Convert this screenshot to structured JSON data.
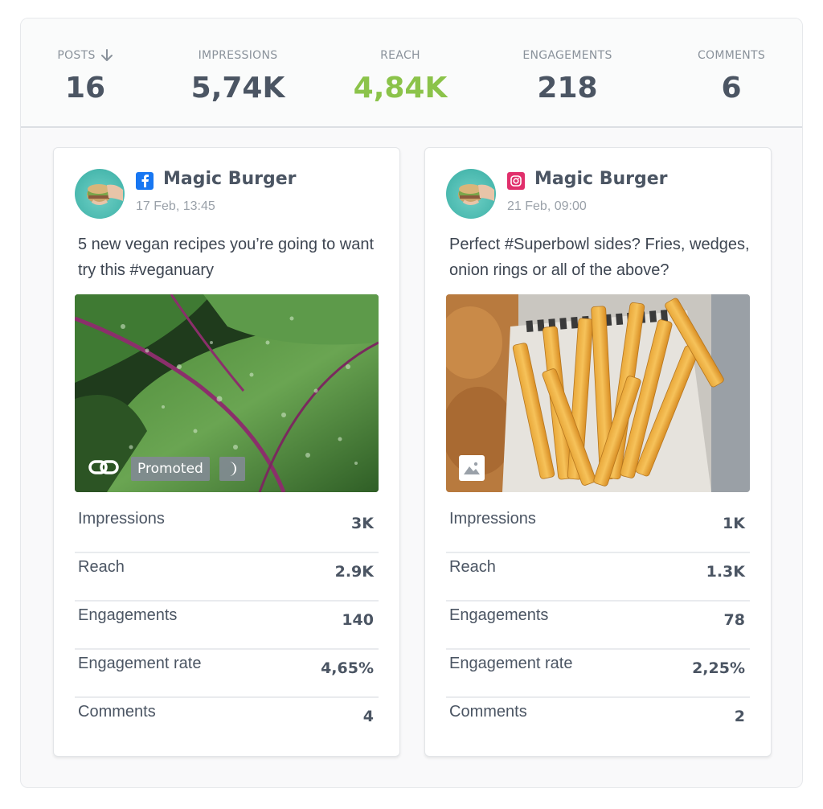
{
  "summary": {
    "posts": {
      "label": "POSTS",
      "value": "16"
    },
    "impressions": {
      "label": "IMPRESSIONS",
      "value": "5,74K"
    },
    "reach": {
      "label": "REACH",
      "value": "4,84K",
      "color": "#8bc34a"
    },
    "engagements": {
      "label": "ENGAGEMENTS",
      "value": "218"
    },
    "comments": {
      "label": "COMMENTS",
      "value": "6"
    }
  },
  "posts": [
    {
      "platform": "facebook",
      "platform_icon": "facebook-icon",
      "author": "Magic Burger",
      "timestamp": "17 Feb, 13:45",
      "text": "5 new vegan recipes you’re going to want try this #veganuary",
      "image": "leafy-greens-photo",
      "badges": {
        "promoted": "Promoted"
      },
      "metrics": [
        {
          "label": "Impressions",
          "value": "3K"
        },
        {
          "label": "Reach",
          "value": "2.9K"
        },
        {
          "label": "Engagements",
          "value": "140"
        },
        {
          "label": "Engagement rate",
          "value": "4,65%"
        },
        {
          "label": "Comments",
          "value": "4"
        }
      ]
    },
    {
      "platform": "instagram",
      "platform_icon": "instagram-icon",
      "author": "Magic Burger",
      "timestamp": "21 Feb, 09:00",
      "text": "Perfect #Superbowl sides? Fries, wedges, onion rings or all of the above?",
      "image": "french-fries-photo",
      "metrics": [
        {
          "label": "Impressions",
          "value": "1K"
        },
        {
          "label": "Reach",
          "value": "1.3K"
        },
        {
          "label": "Engagements",
          "value": "78"
        },
        {
          "label": "Engagement rate",
          "value": "2,25%"
        },
        {
          "label": "Comments",
          "value": "2"
        }
      ]
    }
  ]
}
